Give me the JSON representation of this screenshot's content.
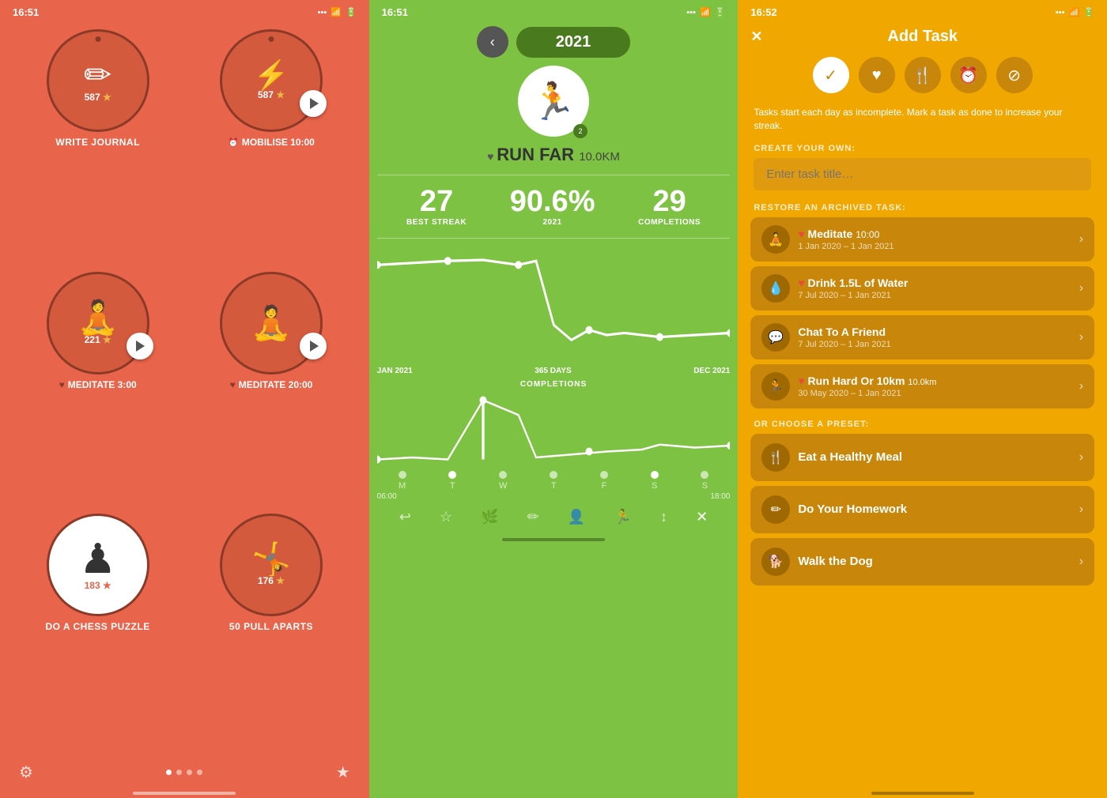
{
  "panel1": {
    "status": {
      "time": "16:51",
      "location": "↑",
      "signal": "▪▪▪",
      "wifi": "wifi",
      "battery": "battery"
    },
    "habits": [
      {
        "id": "write-journal",
        "icon": "✏",
        "count": "587",
        "star": "★",
        "label": "WRITE JOURNAL",
        "hasPlay": false,
        "isWhite": false,
        "hasDot": true,
        "hasClock": false,
        "hasHeart": false,
        "time": ""
      },
      {
        "id": "mobilise",
        "icon": "⚡",
        "count": "587",
        "star": "★",
        "label": "MOBILISE",
        "hasPlay": true,
        "isWhite": false,
        "hasDot": true,
        "hasClock": true,
        "hasHeart": false,
        "time": "10:00"
      },
      {
        "id": "meditate-1",
        "icon": "🧘",
        "count": "221",
        "star": "★",
        "label": "MEDITATE",
        "hasPlay": true,
        "isWhite": false,
        "hasDot": false,
        "hasClock": false,
        "hasHeart": true,
        "time": "3:00"
      },
      {
        "id": "meditate-2",
        "icon": "🧘",
        "count": "",
        "star": "",
        "label": "MEDITATE",
        "hasPlay": true,
        "isWhite": false,
        "hasDot": false,
        "hasClock": false,
        "hasHeart": true,
        "time": "20:00"
      },
      {
        "id": "chess",
        "icon": "♟",
        "count": "183",
        "star": "★",
        "label": "DO A CHESS PUZZLE",
        "hasPlay": false,
        "isWhite": true,
        "hasDot": false,
        "hasClock": false,
        "hasHeart": false,
        "time": ""
      },
      {
        "id": "pull-aparts",
        "icon": "🤸",
        "count": "176",
        "star": "★",
        "label": "50 PULL APARTS",
        "hasPlay": false,
        "isWhite": false,
        "hasDot": false,
        "hasClock": false,
        "hasHeart": false,
        "time": ""
      }
    ],
    "bottomLeft": "⚙",
    "bottomRight": "★"
  },
  "panel2": {
    "status": {
      "time": "16:51",
      "location": "↑"
    },
    "year": "2021",
    "backLabel": "‹",
    "runIcon": "🏃",
    "runBadge": "2",
    "runName": "RUN FAR",
    "runDistance": "10.0KM",
    "stats": [
      {
        "value": "27",
        "label": "BEST STREAK"
      },
      {
        "value": "90.6%",
        "label": "2021"
      },
      {
        "value": "29",
        "label": "COMPLETIONS"
      }
    ],
    "chartAxisLeft": "JAN 2021",
    "chartAxisMid": "365 DAYS",
    "chartAxisRight": "DEC 2021",
    "completionsLabel": "COMPLETIONS",
    "days": [
      "M",
      "T",
      "W",
      "T",
      "F",
      "S",
      "S"
    ],
    "timeAxisLeft": "06:00",
    "timeAxisRight": "18:00"
  },
  "panel3": {
    "status": {
      "time": "16:52",
      "location": "↑"
    },
    "title": "Add Task",
    "closeLabel": "✕",
    "taskIcons": [
      {
        "id": "check",
        "symbol": "✓",
        "active": true
      },
      {
        "id": "heart",
        "symbol": "♥",
        "active": false
      },
      {
        "id": "fork",
        "symbol": "🍴",
        "active": false
      },
      {
        "id": "clock",
        "symbol": "⏰",
        "active": false
      },
      {
        "id": "ban",
        "symbol": "⊘",
        "active": false
      }
    ],
    "description": "Tasks start each day as incomplete. Mark a task as done to increase your streak.",
    "createLabel": "CREATE YOUR OWN:",
    "inputPlaceholder": "Enter task title…",
    "restoreLabel": "RESTORE AN ARCHIVED TASK:",
    "archivedTasks": [
      {
        "id": "meditate",
        "icon": "🧘",
        "title": "Meditate",
        "hasHeart": true,
        "time": "10:00",
        "date": "1 Jan 2020 – 1 Jan 2021"
      },
      {
        "id": "drink-water",
        "icon": "💧",
        "title": "Drink 1.5L of Water",
        "hasHeart": true,
        "time": "",
        "date": "7 Jul 2020 – 1 Jan 2021"
      },
      {
        "id": "chat-friend",
        "icon": "💬",
        "title": "Chat To A Friend",
        "hasHeart": false,
        "time": "",
        "date": "7 Jul 2020 – 1 Jan 2021"
      },
      {
        "id": "run-hard",
        "icon": "🏃",
        "title": "Run Hard Or 10km",
        "hasHeart": true,
        "distance": "10.0km",
        "date": "30 May 2020 – 1 Jan 2021"
      }
    ],
    "presetLabel": "OR CHOOSE A PRESET:",
    "presets": [
      {
        "id": "eat-healthy",
        "icon": "🍴",
        "title": "Eat a Healthy Meal"
      },
      {
        "id": "homework",
        "icon": "✏",
        "title": "Do Your Homework"
      },
      {
        "id": "walk-dog",
        "icon": "🐕",
        "title": "Walk the Dog"
      }
    ]
  }
}
